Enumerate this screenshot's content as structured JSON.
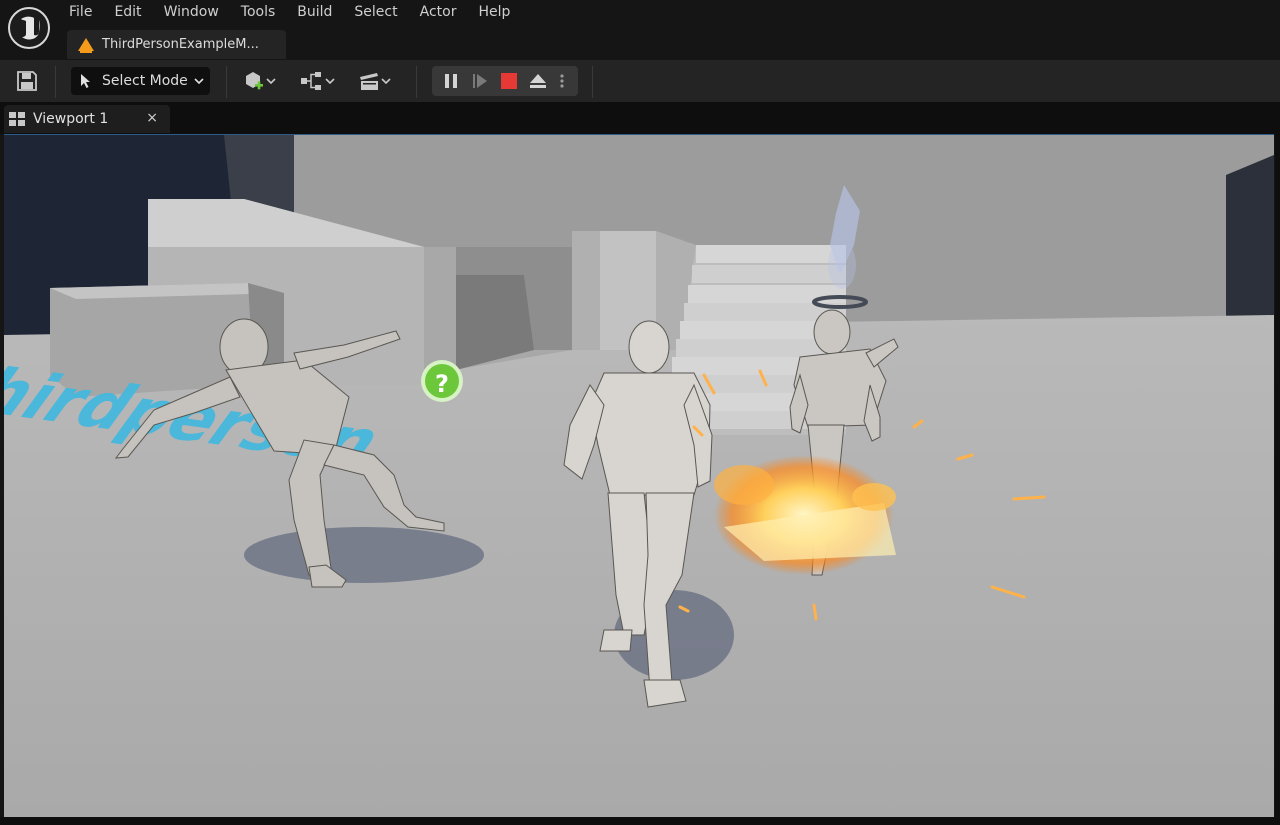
{
  "app": {
    "name": "Unreal Editor"
  },
  "menu": {
    "items": [
      "File",
      "Edit",
      "Window",
      "Tools",
      "Build",
      "Select",
      "Actor",
      "Help"
    ]
  },
  "document_tab": {
    "label": "ThirdPersonExampleM...",
    "icon": "level-warning-icon"
  },
  "toolbar": {
    "save_icon": "save-icon",
    "mode_label": "Select Mode",
    "mode_icon": "select-cursor-icon",
    "buttons": [
      "add-actor-icon",
      "blueprints-icon",
      "cinematics-icon"
    ],
    "play_controls": [
      "pause-icon",
      "step-frame-icon",
      "stop-icon",
      "eject-icon",
      "more-options-icon"
    ]
  },
  "panel": {
    "tab_label": "Viewport 1",
    "close_glyph": "×",
    "tab_icon": "viewport-layout-icon"
  },
  "colors": {
    "accent_blue": "#2d5a86",
    "stop_red": "#e53935",
    "warning_orange": "#f59b1c",
    "floor_text": "#3fb8e0",
    "help_green": "#6cc83a"
  },
  "viewport": {
    "floor_decal_text": "thirdperson",
    "help_marker": "?"
  }
}
